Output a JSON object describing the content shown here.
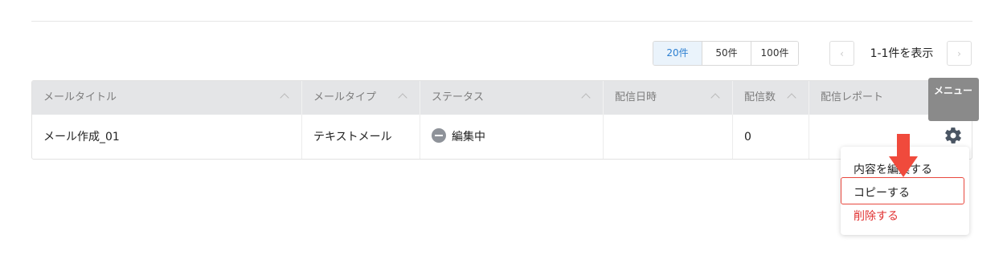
{
  "page_size": {
    "options": [
      "20件",
      "50件",
      "100件"
    ],
    "selected": "20件"
  },
  "pagination": {
    "prev_icon": "chevron-left-icon",
    "next_icon": "chevron-right-icon",
    "summary": "1-1件を表示"
  },
  "table": {
    "columns": [
      "メールタイトル",
      "メールタイプ",
      "ステータス",
      "配信日時",
      "配信数",
      "配信レポート"
    ],
    "rows": [
      {
        "title": "メール作成_01",
        "type": "テキストメール",
        "status": "編集中",
        "sent_at": "",
        "count": "0",
        "report": ""
      }
    ]
  },
  "menu": {
    "tooltip": "メニュー",
    "items": [
      "内容を編集する",
      "コピーする",
      "削除する"
    ],
    "highlighted": "コピーする"
  },
  "colors": {
    "accent": "#2c7fd1",
    "danger": "#e03131",
    "arrow": "#f04a3c",
    "header_bg": "#e4e5e7"
  }
}
